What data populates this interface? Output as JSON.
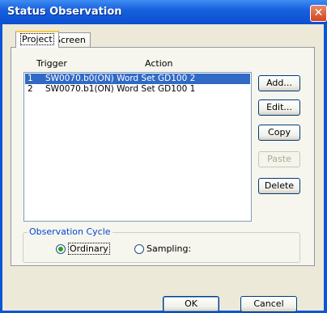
{
  "window": {
    "title": "Status Observation",
    "close_glyph": "✕"
  },
  "tabs": [
    {
      "label": "Project",
      "active": true
    },
    {
      "label": "Screen",
      "active": false
    }
  ],
  "list": {
    "columns": {
      "trigger": "Trigger",
      "action": "Action"
    },
    "rows": [
      {
        "num": "1",
        "text": "SW0070.b0(ON) Word Set GD100  2",
        "selected": true
      },
      {
        "num": "2",
        "text": "SW0070.b1(ON) Word Set GD100  1",
        "selected": false
      }
    ]
  },
  "side_buttons": {
    "add": "Add...",
    "edit": "Edit...",
    "copy": "Copy",
    "paste": "Paste",
    "delete": "Delete"
  },
  "observation_cycle": {
    "label": "Observation Cycle",
    "options": [
      {
        "label": "Ordinary",
        "checked": true
      },
      {
        "label": "Sampling:",
        "checked": false
      }
    ]
  },
  "footer": {
    "ok": "OK",
    "cancel": "Cancel"
  },
  "icons": {
    "close": "close-icon"
  },
  "colors": {
    "selection": "#316ac5",
    "titlebar": "#0a55d8",
    "tab_highlight": "#ffc83c"
  }
}
